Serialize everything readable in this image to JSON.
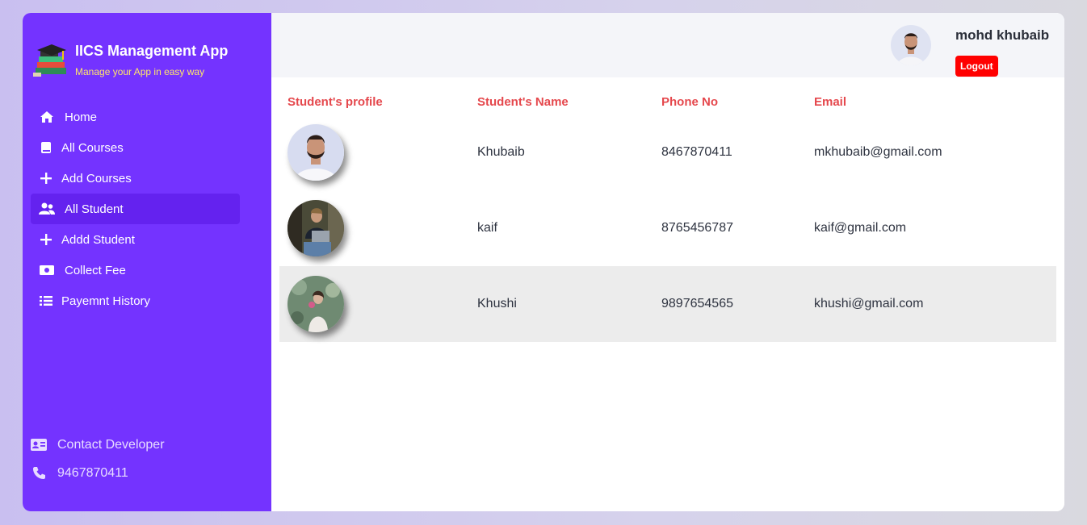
{
  "brand": {
    "title": "IICS Management App",
    "subtitle": "Manage your App in easy way",
    "logo_icon": "graduation-books-icon"
  },
  "nav": {
    "items": [
      {
        "label": "Home",
        "icon": "home-icon"
      },
      {
        "label": "All Courses",
        "icon": "book-icon"
      },
      {
        "label": "Add Courses",
        "icon": "plus-icon"
      },
      {
        "label": "All Student",
        "icon": "users-icon",
        "active": true
      },
      {
        "label": "Addd Student",
        "icon": "plus-icon"
      },
      {
        "label": "Collect Fee",
        "icon": "money-icon"
      },
      {
        "label": "Payemnt History",
        "icon": "list-icon"
      }
    ]
  },
  "contact": {
    "label": "Contact Developer",
    "phone": "9467870411"
  },
  "header": {
    "user_name": "mohd khubaib",
    "logout_label": "Logout"
  },
  "table": {
    "columns": [
      "Student's profile",
      "Student's Name",
      "Phone No",
      "Email"
    ],
    "rows": [
      {
        "name": "Khubaib",
        "phone": "8467870411",
        "email": "mkhubaib@gmail.com"
      },
      {
        "name": "kaif",
        "phone": "8765456787",
        "email": "kaif@gmail.com"
      },
      {
        "name": "Khushi",
        "phone": "9897654565",
        "email": "khushi@gmail.com"
      }
    ]
  },
  "colors": {
    "sidebar": "#7433ff",
    "header_text": "#e5484d",
    "logout": "#ff0000",
    "subtitle": "#ffe66b"
  }
}
